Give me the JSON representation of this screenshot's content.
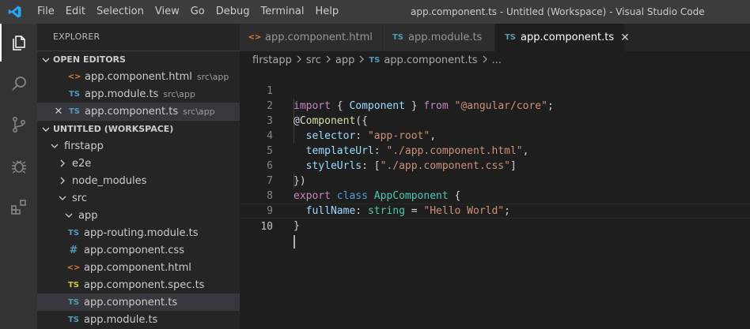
{
  "titlebar": {
    "menu": [
      "File",
      "Edit",
      "Selection",
      "View",
      "Go",
      "Debug",
      "Terminal",
      "Help"
    ],
    "window_title": "app.component.ts - Untitled (Workspace) - Visual Studio Code"
  },
  "activity_bar": {
    "icons": [
      "explorer-icon",
      "search-icon",
      "source-control-icon",
      "debug-icon",
      "extensions-icon"
    ]
  },
  "sidebar": {
    "title": "EXPLORER",
    "open_editors": {
      "label": "OPEN EDITORS",
      "items": [
        {
          "icon": "<>",
          "name": "app.component.html",
          "path": "src\\app"
        },
        {
          "icon": "TS",
          "name": "app.module.ts",
          "path": "src\\app"
        },
        {
          "icon": "TS",
          "name": "app.component.ts",
          "path": "src\\app",
          "close": "✕"
        }
      ]
    },
    "workspace": {
      "label": "UNTITLED (WORKSPACE)",
      "tree": [
        {
          "name": "firstapp"
        },
        {
          "name": "e2e"
        },
        {
          "name": "node_modules"
        },
        {
          "name": "src"
        },
        {
          "name": "app"
        },
        {
          "icon": "TS",
          "name": "app-routing.module.ts"
        },
        {
          "icon": "#",
          "name": "app.component.css"
        },
        {
          "icon": "<>",
          "name": "app.component.html"
        },
        {
          "icon": "TS",
          "name": "app.component.spec.ts"
        },
        {
          "icon": "TS",
          "name": "app.component.ts"
        },
        {
          "icon": "TS",
          "name": "app.module.ts"
        }
      ]
    }
  },
  "tabs": [
    {
      "icon": "<>",
      "label": "app.component.html"
    },
    {
      "icon": "TS",
      "label": "app.module.ts"
    },
    {
      "icon": "TS",
      "label": "app.component.ts",
      "close": "✕"
    }
  ],
  "breadcrumb": {
    "parts": [
      "firstapp",
      "src",
      "app"
    ],
    "file_icon": "TS",
    "file": "app.component.ts",
    "more": "..."
  },
  "editor": {
    "line_numbers": [
      "1",
      "2",
      "3",
      "4",
      "5",
      "6",
      "7",
      "8",
      "9",
      "10"
    ],
    "lines": {
      "l1": {
        "kw": "import",
        "a": " { ",
        "b": "Component",
        "c": " } ",
        "d": "from",
        "e": " ",
        "f": "\"@angular/core\"",
        "g": ";"
      },
      "l2": {
        "a": "@",
        "b": "Component",
        "c": "({"
      },
      "l3": {
        "a": "  ",
        "b": "selector",
        "c": ": ",
        "d": "\"app-root\"",
        "e": ","
      },
      "l4": {
        "a": "  ",
        "b": "templateUrl",
        "c": ": ",
        "d": "\"./app.component.html\"",
        "e": ","
      },
      "l5": {
        "a": "  ",
        "b": "styleUrls",
        "c": ": [",
        "d": "\"./app.component.css\"",
        "e": "]"
      },
      "l6": {
        "a": "})"
      },
      "l7": {
        "a": "export",
        "b": " ",
        "c": "class",
        "d": " ",
        "e": "AppComponent",
        "f": " {"
      },
      "l8": {
        "a": "  ",
        "b": "fullName",
        "c": ": ",
        "d": "string",
        "e": " = ",
        "f": "\"Hello World\"",
        "g": ";"
      },
      "l9": {
        "a": "}"
      }
    }
  },
  "colors": {
    "accent": "#007acc",
    "ts_icon": "#519aba",
    "html_icon": "#e37933",
    "spec_icon": "#cbcb41"
  }
}
